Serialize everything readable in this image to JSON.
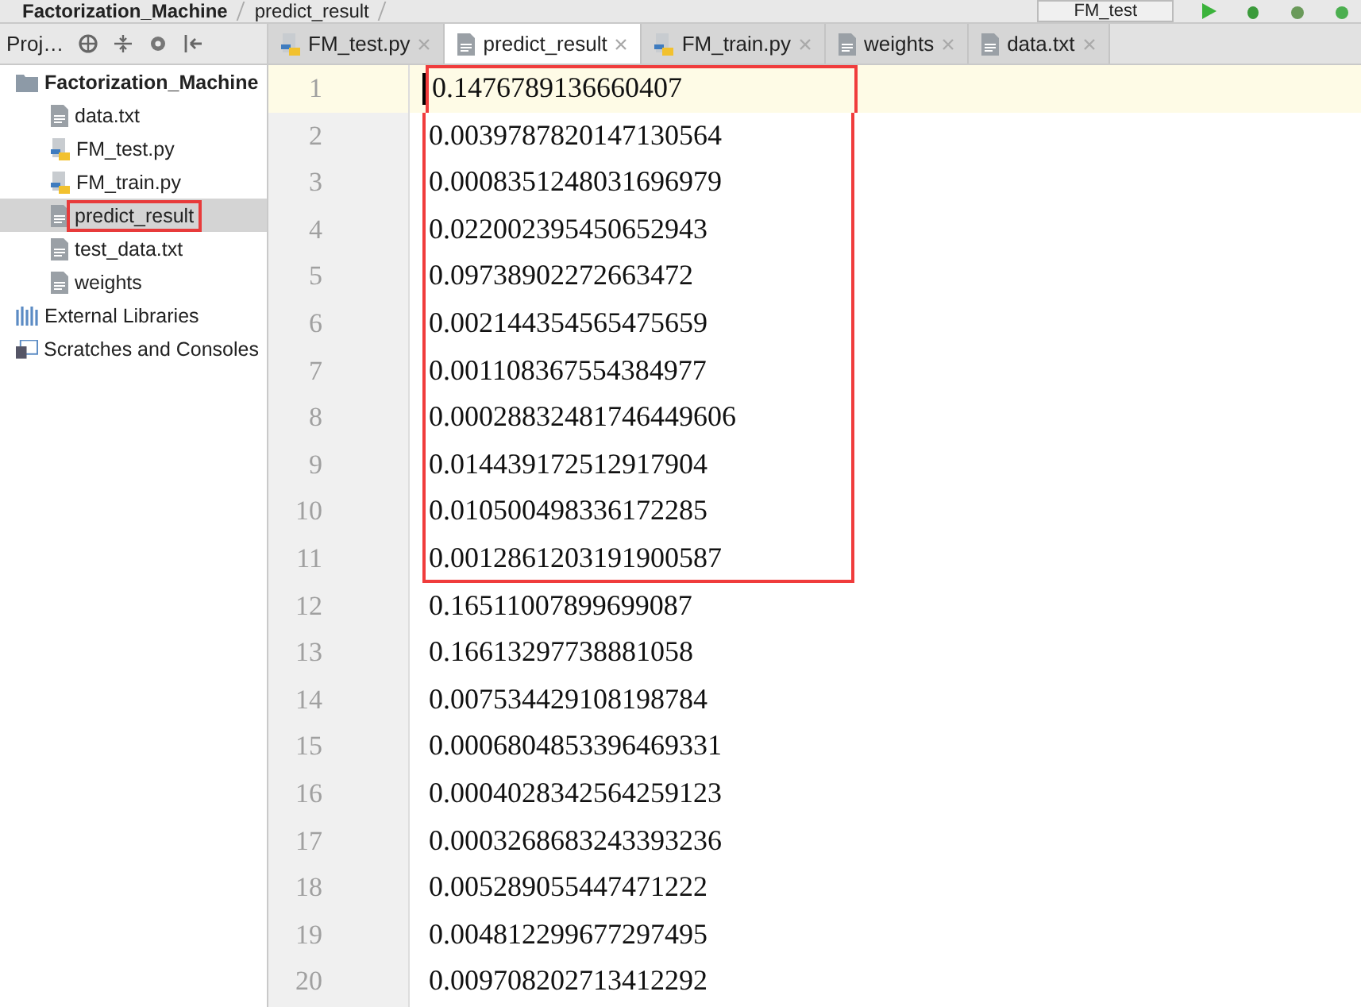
{
  "breadcrumbs": [
    "Factorization_Machine",
    "predict_result"
  ],
  "run_config": {
    "label": "FM_test"
  },
  "project_panel": {
    "title": "Proj…",
    "tree": [
      {
        "label": "Factorization_Machine",
        "kind": "folder",
        "selected": false,
        "highlighted": false,
        "children": [
          {
            "label": "data.txt",
            "kind": "text",
            "selected": false,
            "highlighted": false
          },
          {
            "label": "FM_test.py",
            "kind": "python",
            "selected": false,
            "highlighted": false
          },
          {
            "label": "FM_train.py",
            "kind": "python",
            "selected": false,
            "highlighted": false
          },
          {
            "label": "predict_result",
            "kind": "text",
            "selected": true,
            "highlighted": true
          },
          {
            "label": "test_data.txt",
            "kind": "text",
            "selected": false,
            "highlighted": false
          },
          {
            "label": "weights",
            "kind": "text",
            "selected": false,
            "highlighted": false
          }
        ]
      },
      {
        "label": "External Libraries",
        "kind": "libraries",
        "selected": false,
        "highlighted": false
      },
      {
        "label": "Scratches and Consoles",
        "kind": "scratches",
        "selected": false,
        "highlighted": false
      }
    ]
  },
  "tabs": [
    {
      "label": "FM_test.py",
      "kind": "python",
      "selected": false
    },
    {
      "label": "predict_result",
      "kind": "text",
      "selected": true
    },
    {
      "label": "FM_train.py",
      "kind": "python",
      "selected": false
    },
    {
      "label": "weights",
      "kind": "text",
      "selected": false
    },
    {
      "label": "data.txt",
      "kind": "text",
      "selected": false
    }
  ],
  "editor": {
    "lines": [
      {
        "number": "1",
        "text": "0.1476789136660407",
        "current": true,
        "highlighted": true
      },
      {
        "number": "2",
        "text": "0.0039787820147130564",
        "current": false,
        "highlighted": true
      },
      {
        "number": "3",
        "text": "0.0008351248031696979",
        "current": false,
        "highlighted": true
      },
      {
        "number": "4",
        "text": "0.022002395450652943",
        "current": false,
        "highlighted": true
      },
      {
        "number": "5",
        "text": "0.09738902272663472",
        "current": false,
        "highlighted": true
      },
      {
        "number": "6",
        "text": "0.002144354565475659",
        "current": false,
        "highlighted": true
      },
      {
        "number": "7",
        "text": "0.001108367554384977",
        "current": false,
        "highlighted": true
      },
      {
        "number": "8",
        "text": "0.00028832481746449606",
        "current": false,
        "highlighted": true
      },
      {
        "number": "9",
        "text": "0.014439172512917904",
        "current": false,
        "highlighted": true
      },
      {
        "number": "10",
        "text": "0.010500498336172285",
        "current": false,
        "highlighted": true
      },
      {
        "number": "11",
        "text": "0.0012861203191900587",
        "current": false,
        "highlighted": true
      },
      {
        "number": "12",
        "text": "0.16511007899699087",
        "current": false,
        "highlighted": false
      },
      {
        "number": "13",
        "text": "0.16613297738881058",
        "current": false,
        "highlighted": false
      },
      {
        "number": "14",
        "text": "0.007534429108198784",
        "current": false,
        "highlighted": false
      },
      {
        "number": "15",
        "text": "0.0006804853396469331",
        "current": false,
        "highlighted": false
      },
      {
        "number": "16",
        "text": "0.0004028342564259123",
        "current": false,
        "highlighted": false
      },
      {
        "number": "17",
        "text": "0.0003268683243393236",
        "current": false,
        "highlighted": false
      },
      {
        "number": "18",
        "text": "0.005289055447471222",
        "current": false,
        "highlighted": false
      },
      {
        "number": "19",
        "text": "0.004812299677297495",
        "current": false,
        "highlighted": false
      },
      {
        "number": "20",
        "text": "0.009708202713412292",
        "current": false,
        "highlighted": false
      }
    ]
  }
}
